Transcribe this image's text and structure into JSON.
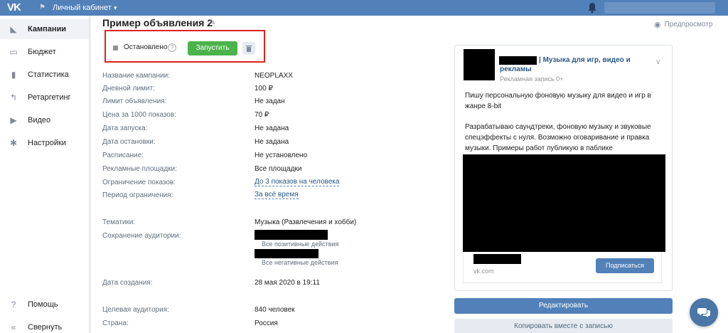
{
  "topbar": {
    "logo": "VK",
    "cabinet_label": "Личный кабинет",
    "chevron": "▾",
    "accent_color": "#5181b8"
  },
  "sidebar": {
    "items": [
      {
        "label": "Кампании",
        "icon": "megaphone-icon",
        "glyph": "◣",
        "active": true
      },
      {
        "label": "Бюджет",
        "icon": "wallet-icon",
        "glyph": "▭",
        "active": false
      },
      {
        "label": "Статистика",
        "icon": "stats-icon",
        "glyph": "▮",
        "active": false
      },
      {
        "label": "Ретаргетинг",
        "icon": "retarget-icon",
        "glyph": "↰",
        "active": false
      },
      {
        "label": "Видео",
        "icon": "video-icon",
        "glyph": "▶",
        "active": false
      },
      {
        "label": "Настройки",
        "icon": "gear-icon",
        "glyph": "✱",
        "active": false
      }
    ],
    "help_label": "Помощь",
    "collapse_label": "Свернуть"
  },
  "main": {
    "title": "Пример объявления 2",
    "preview_label": "Предпросмотр",
    "status": {
      "text": "Остановлено",
      "help": "?",
      "start_button": "Запустить",
      "status_color": "#939393",
      "start_color": "#4bb34b"
    },
    "fields": [
      {
        "label": "Название кампании:",
        "value": "NEOPLAXX"
      },
      {
        "label": "Дневной лимит:",
        "value": "100 ₽"
      },
      {
        "label": "Лимит объявления:",
        "value": "Не задан"
      },
      {
        "label": "Цена за 1000 показов:",
        "value": "70 ₽"
      },
      {
        "label": "Дата запуска:",
        "value": "Не задана"
      },
      {
        "label": "Дата остановки:",
        "value": "Не задана"
      },
      {
        "label": "Расписание:",
        "value": "Не установлено"
      },
      {
        "label": "Рекламные площадки:",
        "value": "Все площадки"
      },
      {
        "label": "Ограничение показов:",
        "value": "До 3 показов на человека",
        "link": true
      },
      {
        "label": "Период ограничения:",
        "value": "За всё время",
        "link": true
      }
    ],
    "topics": {
      "label": "Тематики:",
      "value": "Музыка (Развлечения и хобби)"
    },
    "audience": {
      "label": "Сохранение аудитории:",
      "positive": "Все позитивные действия",
      "negative": "Все негативные действия"
    },
    "created": {
      "label": "Дата создания:",
      "value": "28 мая 2020 в 19:11"
    },
    "target": {
      "label": "Целевая аудитория:",
      "value": "840 человек"
    },
    "country": {
      "label": "Страна:",
      "value": "Россия"
    }
  },
  "preview_card": {
    "group_name_line1": "| Музыка для игр, видео и",
    "group_name_line2": "рекламы",
    "subtitle": "Рекламная запись 0+",
    "text1": "Пишу персональную фоновую музыку для видео и игр в жанре 8-bit",
    "text2": "Разрабатываю саундтреки, фоновую музыку и звуковые спецэффекты с нуля. Возможно оговаривание и правка музыки. Примеры работ публикую в паблике",
    "domain": "vk.com",
    "subscribe_button": "Подписаться"
  },
  "actions": {
    "edit_button": "Редактировать",
    "copy_button": "Копировать вместе с записью"
  }
}
